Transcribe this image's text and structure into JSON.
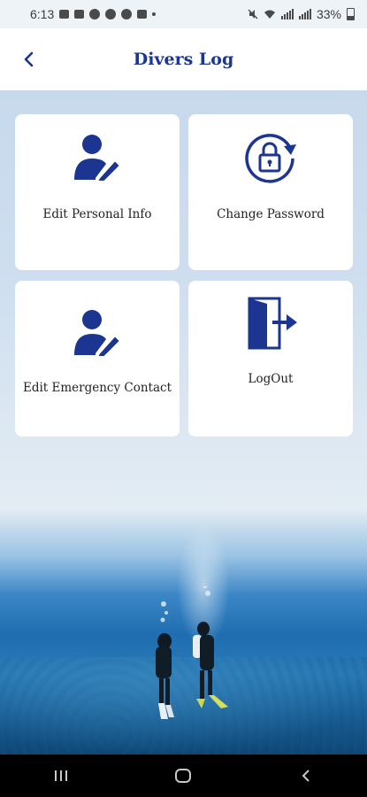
{
  "status_bar": {
    "time": "6:13",
    "battery_text": "33%",
    "icons": [
      "slack-icon",
      "message-icon",
      "b-icon",
      "b-icon",
      "b-icon",
      "mail-icon",
      "dot-icon",
      "mute-icon",
      "wifi-icon",
      "signal-icon",
      "signal-icon",
      "battery-icon"
    ]
  },
  "header": {
    "title": "Divers Log",
    "back_icon": "chevron-left-icon"
  },
  "menu": {
    "cards": [
      {
        "label": "Edit Personal Info",
        "icon": "user-edit-icon"
      },
      {
        "label": "Change Password",
        "icon": "lock-rotate-icon"
      },
      {
        "label": "Edit Emergency Contact",
        "icon": "user-edit-icon"
      },
      {
        "label": "LogOut",
        "icon": "logout-door-icon"
      }
    ]
  },
  "colors": {
    "accent": "#1b3590",
    "header_bg": "#ffffff",
    "card_bg": "#ffffff",
    "nav_bg": "#000000"
  },
  "nav": {
    "buttons": [
      "recent-apps-icon",
      "home-icon",
      "back-icon"
    ]
  }
}
